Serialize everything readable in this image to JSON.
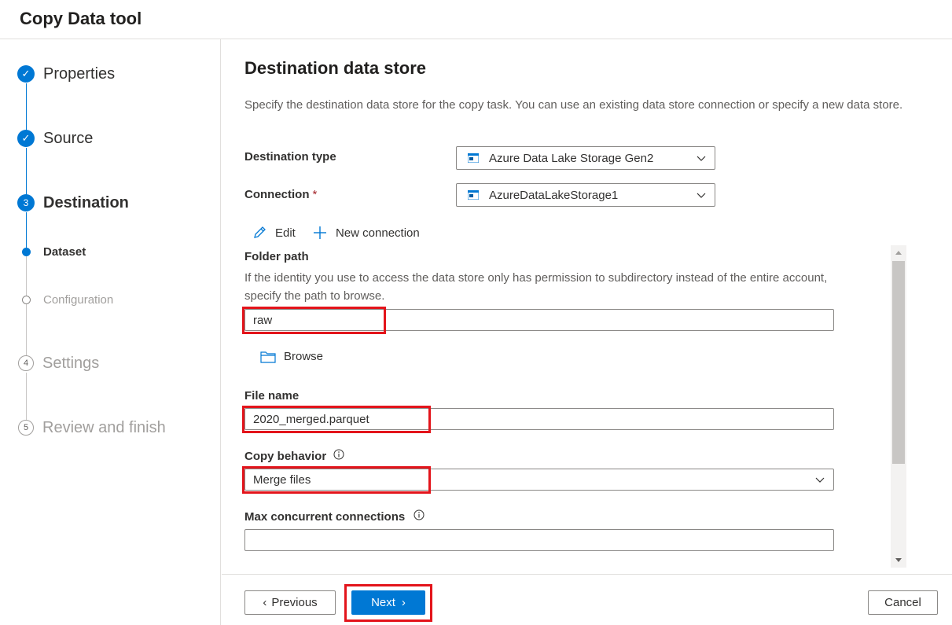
{
  "app": {
    "title": "Copy Data tool"
  },
  "steps": [
    {
      "label": "Properties",
      "state": "done",
      "marker": "✓"
    },
    {
      "label": "Source",
      "state": "done",
      "marker": "✓"
    },
    {
      "label": "Destination",
      "state": "current",
      "marker": "3"
    },
    {
      "label": "Settings",
      "state": "pending",
      "marker": "4"
    },
    {
      "label": "Review and finish",
      "state": "pending",
      "marker": "5"
    }
  ],
  "substeps": [
    {
      "label": "Dataset",
      "state": "current"
    },
    {
      "label": "Configuration",
      "state": "pending"
    }
  ],
  "main": {
    "heading": "Destination data store",
    "description": "Specify the destination data store for the copy task. You can use an existing data store connection or specify a new data store.",
    "destination_type": {
      "label": "Destination type",
      "value": "Azure Data Lake Storage Gen2",
      "icon": "storage-icon"
    },
    "connection": {
      "label": "Connection",
      "required_mark": "*",
      "value": "AzureDataLakeStorage1",
      "icon": "storage-icon"
    },
    "actions": {
      "edit": "Edit",
      "new_connection": "New connection"
    },
    "folder_path": {
      "label": "Folder path",
      "help": "If the identity you use to access the data store only has permission to subdirectory instead of the entire account, specify the path to browse.",
      "value": "raw"
    },
    "browse": "Browse",
    "file_name": {
      "label": "File name",
      "value": "2020_merged.parquet"
    },
    "copy_behavior": {
      "label": "Copy behavior",
      "value": "Merge files"
    },
    "max_connections": {
      "label": "Max concurrent connections",
      "value": ""
    }
  },
  "footer": {
    "previous": "Previous",
    "next": "Next",
    "cancel": "Cancel"
  },
  "colors": {
    "accent": "#0078d4",
    "highlight": "#e3141b"
  }
}
